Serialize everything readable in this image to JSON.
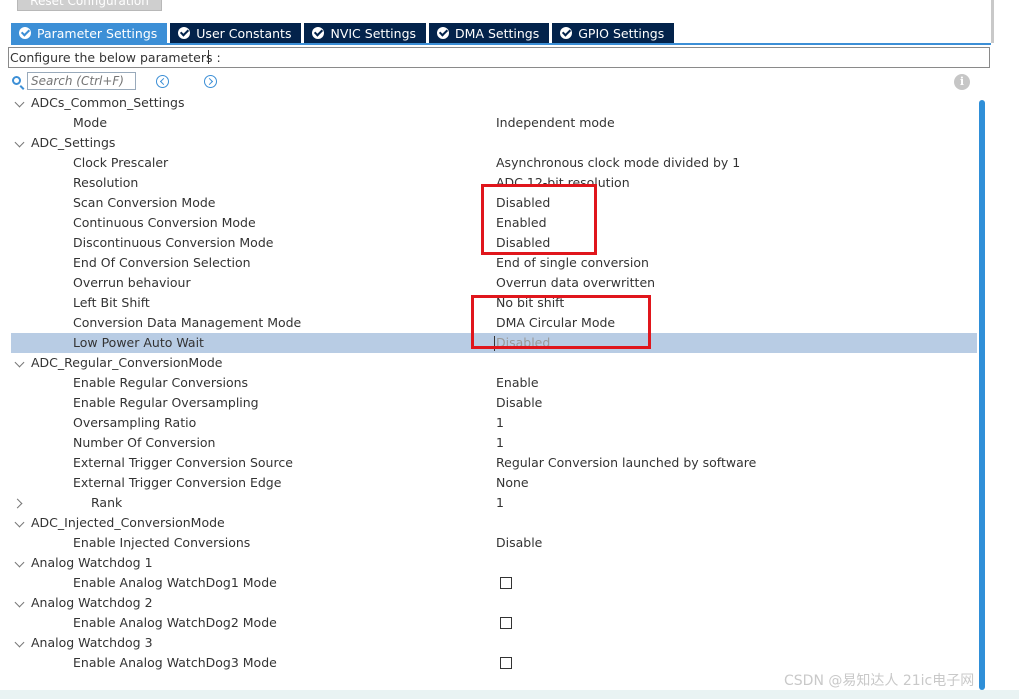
{
  "header": {
    "reset_button": "Reset Configuration"
  },
  "tabs": [
    {
      "label": "Parameter Settings",
      "active": true
    },
    {
      "label": "User Constants",
      "active": false
    },
    {
      "label": "NVIC Settings",
      "active": false
    },
    {
      "label": "DMA Settings",
      "active": false
    },
    {
      "label": "GPIO Settings",
      "active": false
    }
  ],
  "config_label": "Configure the below parameters :",
  "search": {
    "placeholder": "Search (Ctrl+F)",
    "search_icon": "search-icon",
    "prev_icon": "arrow-left-circle-icon",
    "next_icon": "arrow-right-circle-icon",
    "info_icon": "info-icon",
    "info_glyph": "i"
  },
  "tree": {
    "adcs_common": {
      "label": "ADCs_Common_Settings",
      "mode": {
        "name": "Mode",
        "value": "Independent mode"
      }
    },
    "adc_settings": {
      "label": "ADC_Settings",
      "clock_prescaler": {
        "name": "Clock Prescaler",
        "value": "Asynchronous clock mode divided by 1"
      },
      "resolution": {
        "name": "Resolution",
        "value": "ADC 12-bit resolution"
      },
      "scan_mode": {
        "name": "Scan Conversion Mode",
        "value": "Disabled"
      },
      "continuous_mode": {
        "name": "Continuous Conversion Mode",
        "value": "Enabled"
      },
      "discontinuous_mode": {
        "name": "Discontinuous Conversion Mode",
        "value": "Disabled"
      },
      "eoc_selection": {
        "name": "End Of Conversion Selection",
        "value": "End of single conversion"
      },
      "overrun": {
        "name": "Overrun behaviour",
        "value": "Overrun data overwritten"
      },
      "left_bit_shift": {
        "name": "Left Bit Shift",
        "value": "No bit shift"
      },
      "data_mgmt": {
        "name": "Conversion Data Management Mode",
        "value": "DMA Circular Mode"
      },
      "low_power": {
        "name": "Low Power Auto Wait",
        "value": "Disabled"
      }
    },
    "adc_regular": {
      "label": "ADC_Regular_ConversionMode",
      "enable_regular": {
        "name": "Enable Regular Conversions",
        "value": "Enable"
      },
      "enable_oversampling": {
        "name": "Enable Regular Oversampling",
        "value": "Disable"
      },
      "oversampling_ratio": {
        "name": "Oversampling Ratio",
        "value": "1"
      },
      "number_of_conversion": {
        "name": "Number Of Conversion",
        "value": "1"
      },
      "ext_trigger_source": {
        "name": "External Trigger Conversion Source",
        "value": "Regular Conversion launched by software"
      },
      "ext_trigger_edge": {
        "name": "External Trigger Conversion Edge",
        "value": "None"
      },
      "rank": {
        "name": "Rank",
        "value": "1"
      }
    },
    "adc_injected": {
      "label": "ADC_Injected_ConversionMode",
      "enable_injected": {
        "name": "Enable Injected Conversions",
        "value": "Disable"
      }
    },
    "watchdog1": {
      "label": "Analog Watchdog 1",
      "enable": {
        "name": "Enable Analog WatchDog1 Mode",
        "checked": false
      }
    },
    "watchdog2": {
      "label": "Analog Watchdog 2",
      "enable": {
        "name": "Enable Analog WatchDog2 Mode",
        "checked": false
      }
    },
    "watchdog3": {
      "label": "Analog Watchdog 3",
      "enable": {
        "name": "Enable Analog WatchDog3 Mode",
        "checked": false
      }
    }
  },
  "watermark": "CSDN @易知达人  21ic电子网",
  "colors": {
    "tab_bg": "#03234b",
    "tab_active_bg": "#3c8fd6",
    "selected_row": "#b8cce4",
    "annotation": "#e0161c",
    "scrollbar": "#2f8fd8"
  }
}
